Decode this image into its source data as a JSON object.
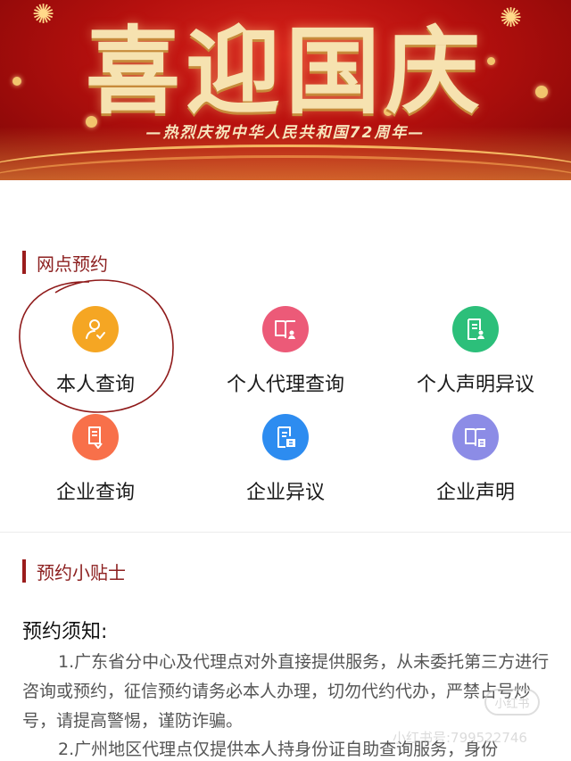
{
  "banner": {
    "title": "喜迎国庆",
    "subtitle": "—热烈庆祝中华人民共和国72周年—"
  },
  "section_booking": {
    "title": "网点预约",
    "items": [
      {
        "label": "本人查询",
        "icon": "person-check-icon",
        "color": "#f5a623"
      },
      {
        "label": "个人代理查询",
        "icon": "book-person-icon",
        "color": "#ec5a78"
      },
      {
        "label": "个人声明异议",
        "icon": "document-person-icon",
        "color": "#2cbf7a"
      },
      {
        "label": "企业查询",
        "icon": "book-pen-icon",
        "color": "#f8704a"
      },
      {
        "label": "企业异议",
        "icon": "document-enterprise-icon",
        "color": "#2d8cf0"
      },
      {
        "label": "企业声明",
        "icon": "book-enterprise-icon",
        "color": "#8c8ce6"
      }
    ]
  },
  "section_tips": {
    "title": "预约小贴士",
    "notice_title": "预约须知:",
    "paragraphs": [
      "1.广东省分中心及代理点对外直接提供服务，从未委托第三方进行咨询或预约，征信预约请务必本人办理，切勿代约代办，严禁占号炒号，请提高警惕，谨防诈骗。",
      "2.广州地区代理点仅提供本人持身份证自助查询服务，身份"
    ]
  },
  "watermark": {
    "text": "小红书号:799522746",
    "badge": "小红书"
  },
  "colors": {
    "accent": "#9b1c1c",
    "banner_red": "#c8161d"
  }
}
